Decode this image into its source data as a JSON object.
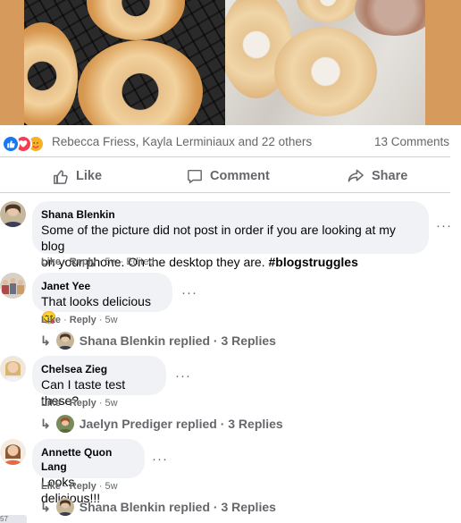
{
  "post": {
    "reactions": [
      "like",
      "love",
      "care"
    ],
    "reacted_by": "Rebecca Friess, Kayla Lerminiaux and 22 others",
    "comment_count": "13 Comments"
  },
  "actions": {
    "like_label": "Like",
    "comment_label": "Comment",
    "share_label": "Share"
  },
  "comments": [
    {
      "author": "Shana Blenkin",
      "text_line1": "Some of the picture did not post in order if you are looking at my blog",
      "text_line2": "on your phone. On the desktop they are. ",
      "hashtag": "#blogstruggles",
      "like": "Like",
      "reply": "Reply",
      "time": "5w",
      "edited": "Edited",
      "avatar_icon": "profile-photo"
    },
    {
      "author": "Janet Yee",
      "text": "That looks delicious 😋",
      "like": "Like",
      "reply": "Reply",
      "time": "5w",
      "replies_summary": "Shana Blenkin replied · 3 Replies",
      "avatar_icon": "profile-photo"
    },
    {
      "author": "Chelsea Zieg",
      "text": "Can I taste test these?",
      "like": "Like",
      "reply": "Reply",
      "time": "5w",
      "replies_summary": "Jaelyn Prediger replied · 3 Replies",
      "avatar_icon": "profile-photo"
    },
    {
      "author": "Annette Quon Lang",
      "text": "Looks delicious!!!",
      "like": "Like",
      "reply": "Reply",
      "time": "5w",
      "replies_summary": "Shana Blenkin replied · 3 Replies",
      "avatar_icon": "profile-photo"
    }
  ],
  "colors": {
    "like_blue": "#1877f2",
    "love_red": "#f33e58",
    "care_yellow": "#f7b125",
    "bubble_bg": "#f0f2f5",
    "muted_text": "#65676b",
    "photo_border": "#d59a5c"
  },
  "icons": {
    "more": "more-horizontal-icon",
    "like": "thumbs-up-icon",
    "comment": "speech-bubble-icon",
    "share": "share-arrow-icon",
    "reply_arrow": "reply-arrow-icon"
  },
  "edge_fragment": "57"
}
